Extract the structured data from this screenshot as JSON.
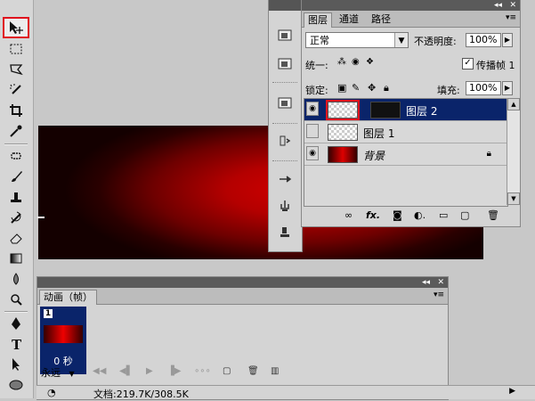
{
  "layers_panel": {
    "tabs": [
      "图层",
      "通道",
      "路径"
    ],
    "blend_mode": "正常",
    "opacity_label": "不透明度:",
    "opacity_value": "100%",
    "unify_label": "统一:",
    "propagate_label": "传播帧 1",
    "propagate_checked": true,
    "lock_label": "锁定:",
    "fill_label": "填充:",
    "fill_value": "100%",
    "layers": [
      {
        "name": "图层 2",
        "selected": true,
        "visible": true,
        "thumb": "transparent"
      },
      {
        "name": "图层 1",
        "selected": false,
        "visible": false,
        "thumb": "transparent"
      },
      {
        "name": "背景",
        "selected": false,
        "visible": true,
        "thumb": "red-gradient",
        "locked": true
      }
    ],
    "bottom_icons": [
      "link-icon",
      "fx-icon",
      "mask-icon",
      "adjustment-icon",
      "group-icon",
      "new-layer-icon",
      "trash-icon"
    ]
  },
  "animation_panel": {
    "tab_title": "动画（帧）",
    "frames": [
      {
        "number": "1",
        "delay": "0 秒"
      }
    ],
    "loop": "永远"
  },
  "status_bar": {
    "doc_info": "文档:219.7K/308.5K"
  },
  "colors": {
    "accent_red": "#e0141e",
    "selection_blue": "#0a246a",
    "canvas_red": "#c80000"
  }
}
